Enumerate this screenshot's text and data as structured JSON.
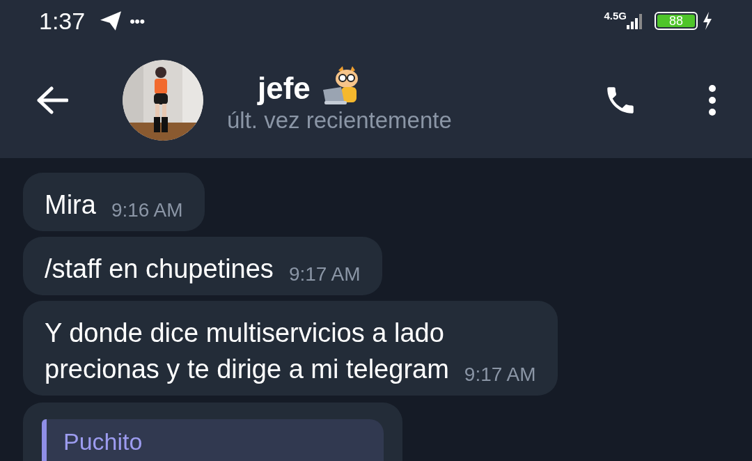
{
  "status_bar": {
    "time": "1:37",
    "notification_icons": "•••",
    "network": "4.5G",
    "battery": "88",
    "charging": true
  },
  "header": {
    "title": "jefe",
    "subtitle": "últ. vez recientemente"
  },
  "messages": [
    {
      "kind": "text",
      "text": "Mira",
      "time": "9:16 AM"
    },
    {
      "kind": "text",
      "text": "/staff en chupetines",
      "time": "9:17 AM"
    },
    {
      "kind": "text",
      "text": "Y donde dice multiservicios a lado\nprecionas y te dirige a mi telegram",
      "time": "9:17 AM"
    },
    {
      "kind": "reply",
      "quote_author": "Puchito"
    }
  ]
}
